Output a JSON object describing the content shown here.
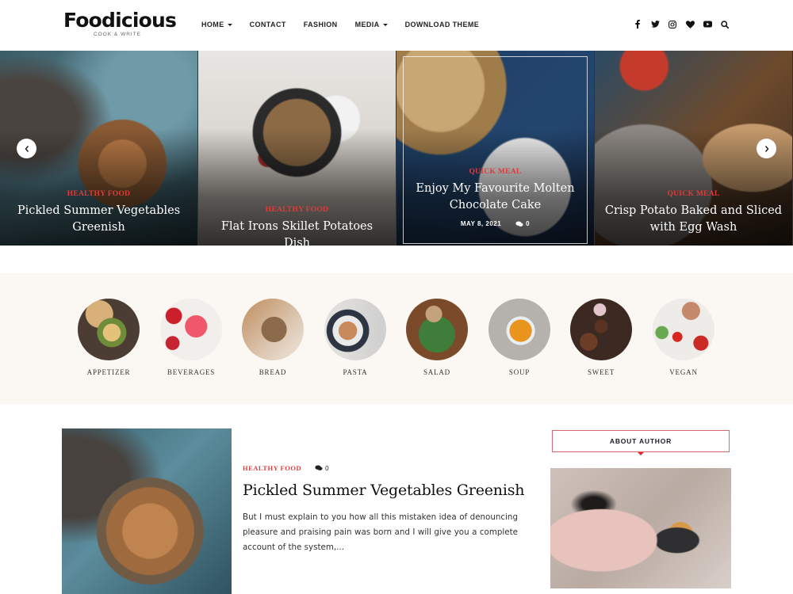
{
  "brand": {
    "title": "Foodicious",
    "tagline": "COOK & WRITE"
  },
  "nav": {
    "items": [
      {
        "label": "HOME",
        "has_dropdown": true
      },
      {
        "label": "CONTACT",
        "has_dropdown": false
      },
      {
        "label": "FASHION",
        "has_dropdown": false
      },
      {
        "label": "MEDIA",
        "has_dropdown": true
      },
      {
        "label": "DOWNLOAD THEME",
        "has_dropdown": false
      }
    ]
  },
  "social_icons": [
    "facebook-icon",
    "twitter-icon",
    "instagram-icon",
    "heart-icon",
    "youtube-icon",
    "search-icon"
  ],
  "slider": {
    "prev_icon": "chevron-left-icon",
    "next_icon": "chevron-right-icon",
    "slides": [
      {
        "category": "HEALTHY FOOD",
        "title": "Pickled Summer Vegetables Greenish"
      },
      {
        "category": "HEALTHY FOOD",
        "title": "Flat Irons Skillet Potatoes Dish"
      },
      {
        "category": "QUICK MEAL",
        "title": "Enjoy My Favourite Molten Chocolate Cake",
        "date": "MAY 8, 2021",
        "comments": "0",
        "active": true
      },
      {
        "category": "QUICK MEAL",
        "title": "Crisp Potato Baked and Sliced with Egg Wash"
      }
    ]
  },
  "categories": [
    {
      "label": "APPETIZER"
    },
    {
      "label": "BEVERAGES"
    },
    {
      "label": "BREAD"
    },
    {
      "label": "PASTA"
    },
    {
      "label": "SALAD"
    },
    {
      "label": "SOUP"
    },
    {
      "label": "SWEET"
    },
    {
      "label": "VEGAN"
    }
  ],
  "post": {
    "category": "HEALTHY FOOD",
    "comments": "0",
    "title": "Pickled Summer Vegetables Greenish",
    "excerpt": "But I must explain to you how all this mistaken idea of denouncing pleasure and praising pain was born and I will give you a complete account of the system,..."
  },
  "sidebar": {
    "about_title": "ABOUT AUTHOR"
  },
  "colors": {
    "accent_red": "#e23a3a",
    "category_band": "#fbf8f3",
    "about_border": "#d9696c"
  }
}
